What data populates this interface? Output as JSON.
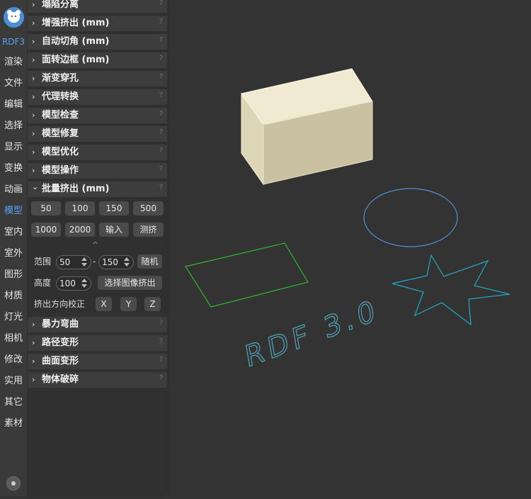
{
  "nav": {
    "app": "RDF3",
    "items": [
      "渲染",
      "文件",
      "编辑",
      "选择",
      "显示",
      "变换",
      "动画",
      "模型",
      "室内",
      "室外",
      "图形",
      "材质",
      "灯光",
      "相机",
      "修改",
      "实用",
      "其它",
      "素材"
    ],
    "active": "模型"
  },
  "sections_top": [
    {
      "label": "塌陷分离",
      "arrow": "›"
    },
    {
      "label": "增强挤出 (mm)",
      "arrow": "›"
    },
    {
      "label": "自动切角 (mm)",
      "arrow": "›"
    },
    {
      "label": "面转边框 (mm)",
      "arrow": "›"
    },
    {
      "label": "渐变穿孔",
      "arrow": "›"
    },
    {
      "label": "代理转换",
      "arrow": "›"
    },
    {
      "label": "模型检查",
      "arrow": "›"
    },
    {
      "label": "模型修复",
      "arrow": "›"
    },
    {
      "label": "模型优化",
      "arrow": "›"
    },
    {
      "label": "模型操作",
      "arrow": "›"
    }
  ],
  "help_mark": "?",
  "batch": {
    "label": "批量挤出 (mm)",
    "arrow": "⌄",
    "row1": [
      "50",
      "100",
      "150",
      "500"
    ],
    "row2": [
      "1000",
      "2000",
      "输入",
      "测挤"
    ],
    "collapse_icon": "^",
    "range_label": "范围",
    "range_min": "50",
    "range_sep": "-",
    "range_max": "150",
    "random_label": "随机",
    "height_label": "高度",
    "height_value": "100",
    "image_extrude": "选择图像挤出",
    "dir_label": "挤出方向校正",
    "axes": [
      "X",
      "Y",
      "Z"
    ]
  },
  "sections_bottom": [
    {
      "label": "暴力弯曲",
      "arrow": "›"
    },
    {
      "label": "路径变形",
      "arrow": "›"
    },
    {
      "label": "曲面变形",
      "arrow": "›"
    },
    {
      "label": "物体破碎",
      "arrow": "›"
    }
  ],
  "scene": {
    "text_3d": "RDF 3.0",
    "colors": {
      "box_top": "#f1ead2",
      "box_front": "#dcd5b6",
      "box_side": "#c7bf9f",
      "ellipse": "#4d8fd6",
      "rect": "#31b530",
      "star": "#22a9c2",
      "text": "#52a4b8"
    }
  }
}
